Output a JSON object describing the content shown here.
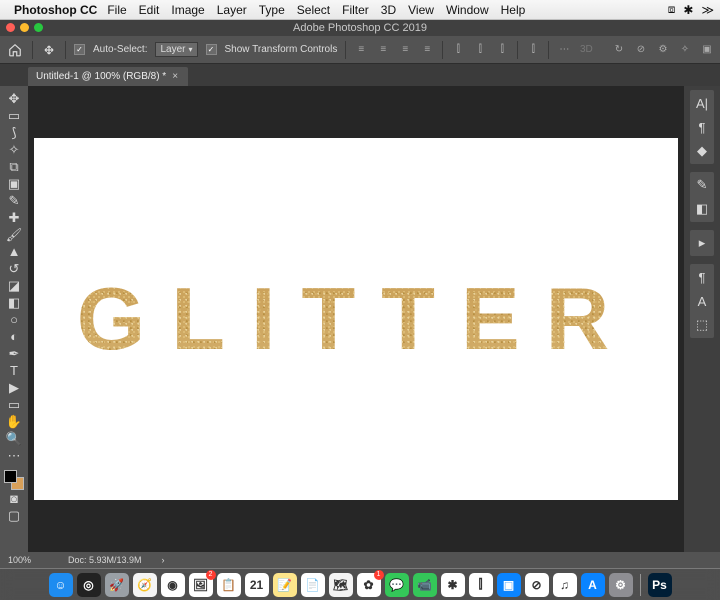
{
  "mac_menu": {
    "app_name": "Photoshop CC",
    "items": [
      "File",
      "Edit",
      "Image",
      "Layer",
      "Type",
      "Select",
      "Filter",
      "3D",
      "View",
      "Window",
      "Help"
    ],
    "status_icons": [
      "dropbox-icon",
      "slack-icon",
      "chevrons-icon"
    ]
  },
  "titlebar": {
    "title": "Adobe Photoshop CC 2019"
  },
  "options_bar": {
    "auto_select_checked": true,
    "auto_select_label": "Auto-Select:",
    "auto_select_target": "Layer",
    "show_transform_checked": true,
    "show_transform_label": "Show Transform Controls"
  },
  "doc_tab": {
    "title": "Untitled-1 @ 100% (RGB/8) *"
  },
  "canvas": {
    "text": "GLITTER"
  },
  "status": {
    "zoom": "100%",
    "doc_size": "Doc: 5.93M/13.9M",
    "arrow": "›"
  },
  "left_tools": [
    {
      "name": "move-tool",
      "glyph": "✥"
    },
    {
      "name": "marquee-tool",
      "glyph": "▭"
    },
    {
      "name": "lasso-tool",
      "glyph": "⟆"
    },
    {
      "name": "magic-wand-tool",
      "glyph": "✧"
    },
    {
      "name": "crop-tool",
      "glyph": "⧉"
    },
    {
      "name": "frame-tool",
      "glyph": "▣"
    },
    {
      "name": "eyedropper-tool",
      "glyph": "✎"
    },
    {
      "name": "spot-heal-tool",
      "glyph": "✚"
    },
    {
      "name": "brush-tool",
      "glyph": "🖌"
    },
    {
      "name": "clone-stamp-tool",
      "glyph": "▲"
    },
    {
      "name": "history-brush-tool",
      "glyph": "↺"
    },
    {
      "name": "eraser-tool",
      "glyph": "◪"
    },
    {
      "name": "gradient-tool",
      "glyph": "◧"
    },
    {
      "name": "blur-tool",
      "glyph": "○"
    },
    {
      "name": "dodge-tool",
      "glyph": "◐"
    },
    {
      "name": "pen-tool",
      "glyph": "✒"
    },
    {
      "name": "type-tool",
      "glyph": "T"
    },
    {
      "name": "path-select-tool",
      "glyph": "▶"
    },
    {
      "name": "shape-tool",
      "glyph": "▭"
    },
    {
      "name": "hand-tool",
      "glyph": "✋"
    },
    {
      "name": "zoom-tool",
      "glyph": "🔍"
    },
    {
      "name": "more-tools",
      "glyph": "⋯"
    }
  ],
  "right_panels": [
    {
      "group": [
        {
          "name": "character-panel",
          "glyph": "A|"
        },
        {
          "name": "paragraph-panel",
          "glyph": "¶"
        },
        {
          "name": "glyphs-panel",
          "glyph": "◆"
        }
      ]
    },
    {
      "group": [
        {
          "name": "brush-settings-panel",
          "glyph": "✎"
        },
        {
          "name": "swatches-panel",
          "glyph": "◧"
        }
      ]
    },
    {
      "group": [
        {
          "name": "actions-panel",
          "glyph": "▸"
        }
      ]
    },
    {
      "group": [
        {
          "name": "paragraph-styles-panel",
          "glyph": "¶"
        },
        {
          "name": "character-styles-panel",
          "glyph": "A"
        },
        {
          "name": "3d-panel",
          "glyph": "⬚"
        }
      ]
    }
  ],
  "dock": [
    {
      "name": "finder",
      "bg": "#1e8cf0",
      "glyph": "☺",
      "badge": null
    },
    {
      "name": "siri",
      "bg": "#222",
      "glyph": "◎",
      "badge": null
    },
    {
      "name": "launchpad",
      "bg": "#9aa0a6",
      "glyph": "🚀",
      "badge": null
    },
    {
      "name": "safari",
      "bg": "#f4f4f4",
      "glyph": "🧭",
      "badge": null
    },
    {
      "name": "chrome",
      "bg": "#fff",
      "glyph": "◉",
      "badge": null
    },
    {
      "name": "preview",
      "bg": "#fff",
      "glyph": "🖼",
      "badge": "2"
    },
    {
      "name": "reminders",
      "bg": "#fff",
      "glyph": "📋",
      "badge": null
    },
    {
      "name": "calendar",
      "bg": "#fff",
      "glyph": "21",
      "badge": null
    },
    {
      "name": "notes",
      "bg": "#fde58b",
      "glyph": "📝",
      "badge": null
    },
    {
      "name": "pages",
      "bg": "#fff",
      "glyph": "📄",
      "badge": null
    },
    {
      "name": "maps",
      "bg": "#f4f4f4",
      "glyph": "🗺",
      "badge": null
    },
    {
      "name": "photos",
      "bg": "#fff",
      "glyph": "✿",
      "badge": "1"
    },
    {
      "name": "messages",
      "bg": "#34c759",
      "glyph": "💬",
      "badge": null
    },
    {
      "name": "facetime",
      "bg": "#34c759",
      "glyph": "📹",
      "badge": null
    },
    {
      "name": "slack",
      "bg": "#fff",
      "glyph": "✱",
      "badge": null
    },
    {
      "name": "numbers",
      "bg": "#fff",
      "glyph": "⫿",
      "badge": null
    },
    {
      "name": "keynote",
      "bg": "#0a84ff",
      "glyph": "▣",
      "badge": null
    },
    {
      "name": "noentry",
      "bg": "#fff",
      "glyph": "⊘",
      "badge": null
    },
    {
      "name": "itunes",
      "bg": "#fff",
      "glyph": "♫",
      "badge": null
    },
    {
      "name": "appstore",
      "bg": "#0a84ff",
      "glyph": "A",
      "badge": null
    },
    {
      "name": "settings",
      "bg": "#8e8e93",
      "glyph": "⚙",
      "badge": null
    }
  ],
  "dock_right": [
    {
      "name": "photoshop",
      "bg": "#001e36",
      "glyph": "Ps",
      "badge": null
    }
  ]
}
